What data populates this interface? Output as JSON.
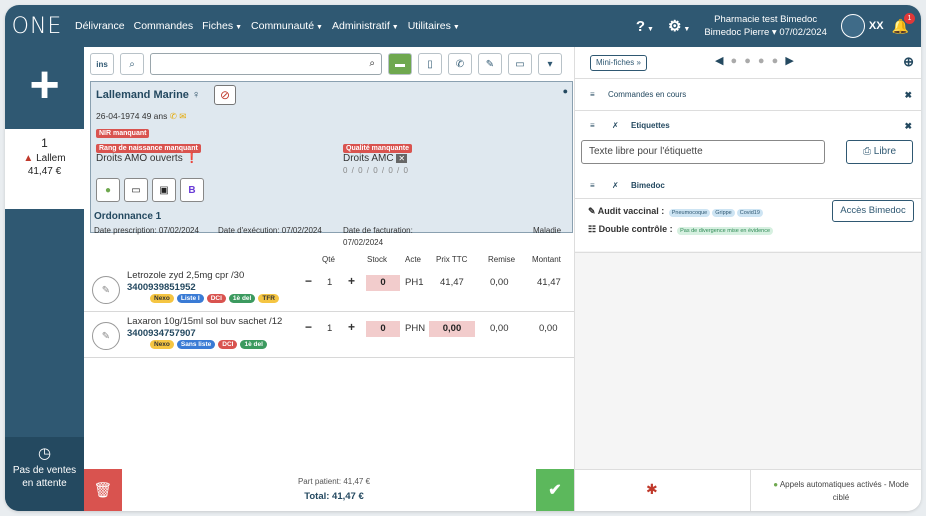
{
  "app": {
    "logo": "ONE"
  },
  "menu": [
    {
      "label": "Délivrance",
      "caret": false
    },
    {
      "label": "Commandes",
      "caret": false
    },
    {
      "label": "Fiches",
      "caret": true
    },
    {
      "label": "Communauté",
      "caret": true
    },
    {
      "label": "Administratif",
      "caret": true
    },
    {
      "label": "Utilitaires",
      "caret": true
    }
  ],
  "header": {
    "help": "?",
    "pharmacy": "Pharmacie test Bimedoc",
    "user_date": "Bimedoc Pierre ▾ 07/02/2024",
    "initials": "XX",
    "notif_count": "1"
  },
  "sidebar": {
    "sale_number": "1",
    "sale_name": "Lallem",
    "sale_amount": "41,47 €",
    "pending_l1": "Pas de ventes",
    "pending_l2": "en attente"
  },
  "toolbar": {
    "ins": "ins",
    "search_value": ""
  },
  "patient": {
    "name": "Lallemand Marine",
    "gender": "♀",
    "dob": "26-04-1974 49 ans",
    "tag_nir": "NIR manquant",
    "tag_rang": "Rang de naissance manquant",
    "tag_qualite": "Qualité manquante",
    "amo": "Droits AMO ouverts",
    "amc": "Droits AMC",
    "amc_values": "0 / 0 / 0 / 0 / 0"
  },
  "prescription": {
    "title": "Ordonnance 1",
    "date_prescription": "Date prescription: 07/02/2024",
    "date_execution": "Date d'exécution: 07/02/2024",
    "date_facturation_l1": "Date de facturation:",
    "date_facturation_l2": "07/02/2024",
    "regime": "Maladie"
  },
  "columns": {
    "qte": "Qté",
    "stock": "Stock",
    "acte": "Acte",
    "prix": "Prix TTC",
    "remise": "Remise",
    "montant": "Montant"
  },
  "lines": [
    {
      "name": "Letrozole zyd 2,5mg cpr /30",
      "code": "3400939851952",
      "qty": "1",
      "stock": "0",
      "acte": "PH1",
      "prix": "41,47",
      "remise": "0,00",
      "montant": "41,47",
      "pills": [
        {
          "text": "Nexo",
          "bg": "#f5c542",
          "fg": "#333"
        },
        {
          "text": "Liste I",
          "bg": "#3a7bd5",
          "fg": "#fff"
        },
        {
          "text": "DCI",
          "bg": "#d9534f",
          "fg": "#fff"
        },
        {
          "text": "1è del",
          "bg": "#3c9a5f",
          "fg": "#fff"
        },
        {
          "text": "TFR",
          "bg": "#f5c542",
          "fg": "#333"
        }
      ]
    },
    {
      "name": "Laxaron 10g/15ml sol buv sachet /12",
      "code": "3400934757907",
      "qty": "1",
      "stock": "0",
      "acte": "PHN",
      "prix": "0,00",
      "remise": "0,00",
      "montant": "0,00",
      "pills": [
        {
          "text": "Nexo",
          "bg": "#f5c542",
          "fg": "#333"
        },
        {
          "text": "Sans liste",
          "bg": "#3a7bd5",
          "fg": "#fff"
        },
        {
          "text": "DCI",
          "bg": "#d9534f",
          "fg": "#fff"
        },
        {
          "text": "1è del",
          "bg": "#3c9a5f",
          "fg": "#fff"
        }
      ]
    }
  ],
  "totals": {
    "part_patient": "Part patient: 41,47 €",
    "total": "Total: 41,47 €"
  },
  "right": {
    "mini_fiches": "Mini-fiches »",
    "panel_commandes": "Commandes en cours",
    "panel_etiquettes": "Etiquettes",
    "libre_placeholder": "Texte libre pour l'étiquette",
    "libre_button": "Libre",
    "panel_bimedoc": "Bimedoc",
    "audit_label": "Audit vaccinal :",
    "audit_tags": [
      "Pneumocoque",
      "Grippe",
      "Covid19"
    ],
    "double_label": "Double contrôle :",
    "double_tag": "Pas de divergence mise en évidence",
    "acces_button": "Accès Bimedoc",
    "auto_calls_l1": "Appels automatiques activés - Mode",
    "auto_calls_l2": "ciblé"
  },
  "colors": {
    "nav": "#2f5872",
    "danger": "#d9534f",
    "success": "#5cb85c"
  }
}
